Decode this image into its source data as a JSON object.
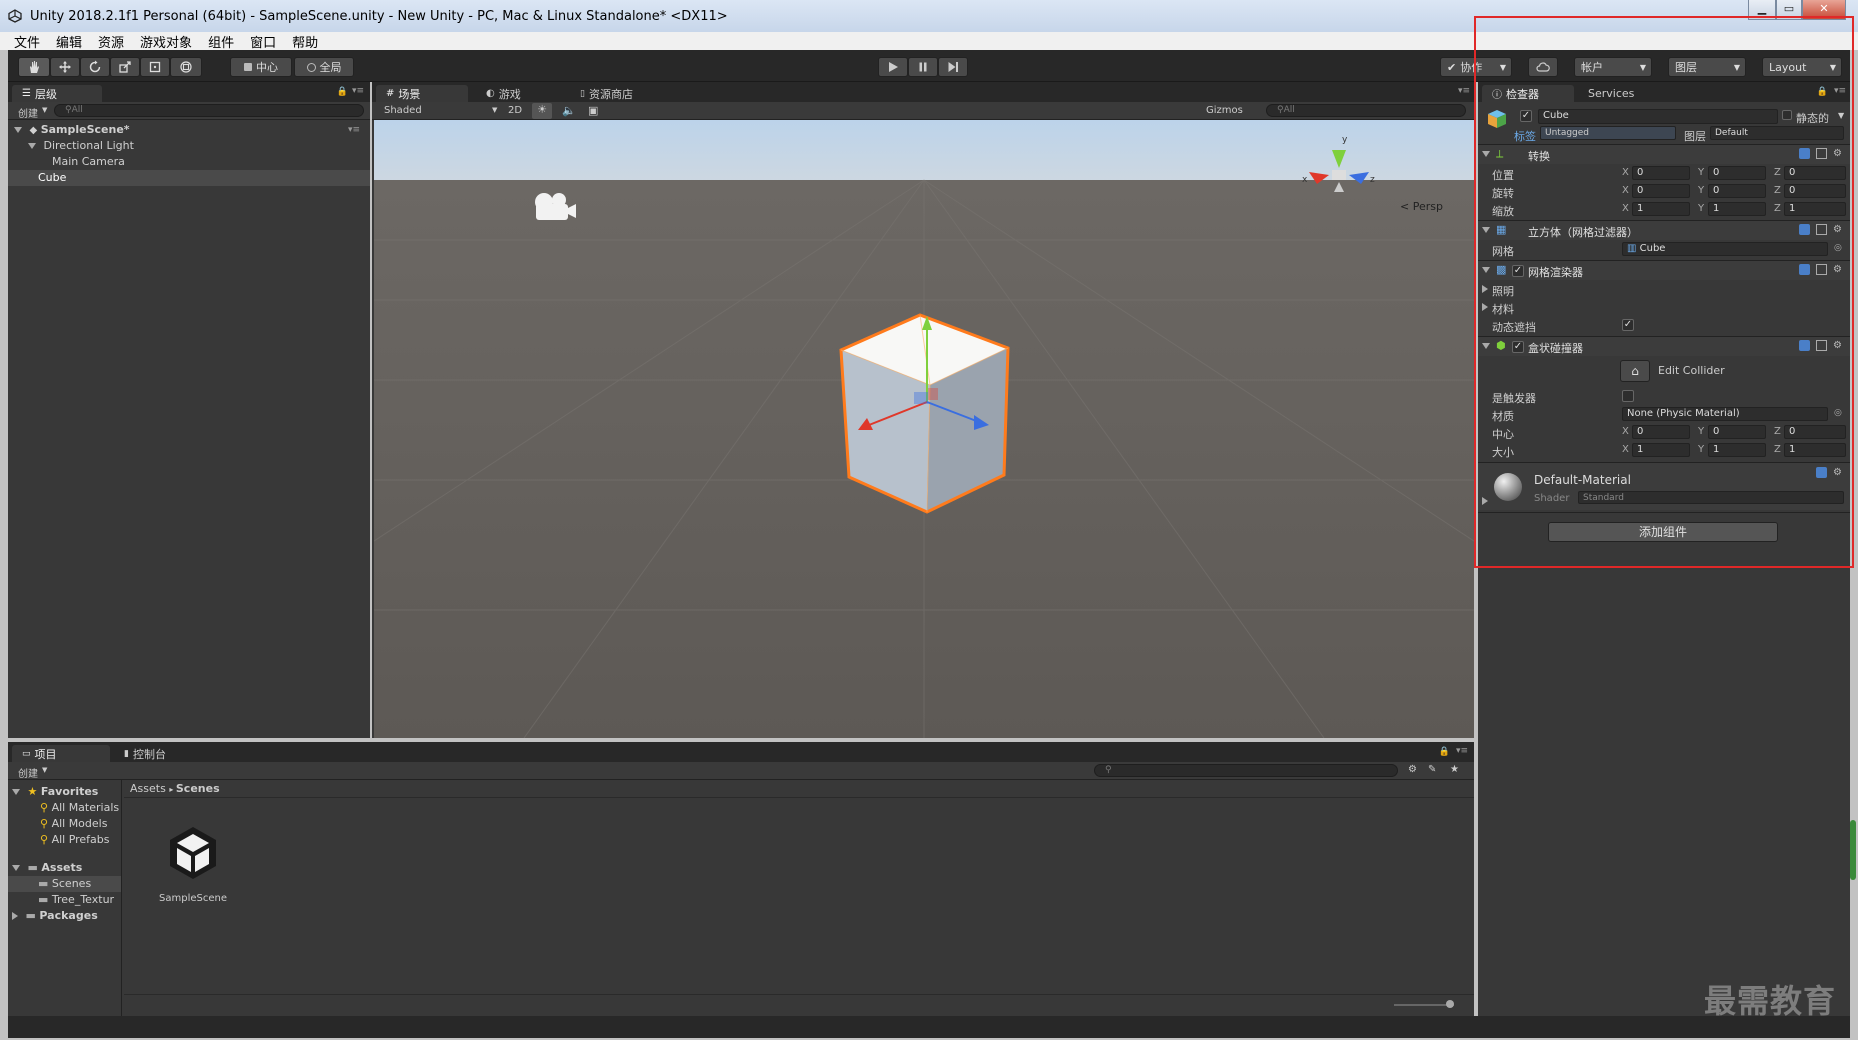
{
  "window": {
    "title": "Unity 2018.2.1f1 Personal (64bit) - SampleScene.unity - New Unity - PC, Mac & Linux Standalone* <DX11>",
    "minimize": "▁",
    "maximize": "▭",
    "close": "✕"
  },
  "menu": [
    "文件",
    "编辑",
    "资源",
    "游戏对象",
    "组件",
    "窗口",
    "帮助"
  ],
  "toolbar": {
    "pivot": "中心",
    "global": "全局",
    "collab": "协作",
    "account": "帐户",
    "layers": "图层",
    "layout": "Layout"
  },
  "hierarchy": {
    "tab": "层级",
    "create": "创建",
    "search_placeholder": "All",
    "scene": "SampleScene*",
    "items": [
      "Directional Light",
      "Main Camera",
      "Cube"
    ]
  },
  "scene_view": {
    "tabs": [
      "场景",
      "游戏",
      "资源商店"
    ],
    "shading": "Shaded",
    "mode_2d": "2D",
    "gizmos": "Gizmos",
    "search_placeholder": "All",
    "persp": "< Persp"
  },
  "inspector": {
    "tabs": [
      "检查器",
      "Services"
    ],
    "object_name": "Cube",
    "static_label": "静态的",
    "tag_label": "标签",
    "tag_value": "Untagged",
    "layer_label": "图层",
    "layer_value": "Default",
    "transform": {
      "title": "转换",
      "position_label": "位置",
      "rotation_label": "旋转",
      "scale_label": "缩放",
      "position": [
        "0",
        "0",
        "0"
      ],
      "rotation": [
        "0",
        "0",
        "0"
      ],
      "scale": [
        "1",
        "1",
        "1"
      ]
    },
    "mesh_filter": {
      "title": "立方体（网格过滤器）",
      "mesh_label": "网格",
      "mesh_value": "Cube"
    },
    "mesh_renderer": {
      "title": "网格渲染器",
      "lighting": "照明",
      "materials": "材料",
      "dynamic_occluded": "动态遮挡"
    },
    "box_collider": {
      "title": "盒状碰撞器",
      "edit_collider": "Edit Collider",
      "is_trigger": "是触发器",
      "material_label": "材质",
      "material_value": "None (Physic Material)",
      "center_label": "中心",
      "size_label": "大小",
      "center": [
        "0",
        "0",
        "0"
      ],
      "size": [
        "1",
        "1",
        "1"
      ]
    },
    "material": {
      "name": "Default-Material",
      "shader_label": "Shader",
      "shader_value": "Standard"
    },
    "add_component": "添加组件"
  },
  "project": {
    "tabs": [
      "项目",
      "控制台"
    ],
    "create": "创建",
    "favorites": "Favorites",
    "favorite_items": [
      "All Materials",
      "All Models",
      "All Prefabs"
    ],
    "assets": "Assets",
    "asset_folders": [
      "Scenes",
      "Tree_Textur"
    ],
    "packages": "Packages",
    "breadcrumb": [
      "Assets",
      "Scenes"
    ],
    "files": [
      "SampleScene"
    ]
  },
  "axis_labels": {
    "x": "x",
    "y": "y",
    "z": "z"
  },
  "watermark": "最需教育",
  "colors": {
    "highlight": "#e02828",
    "selection": "#ff7b1c",
    "accent_blue": "#3d6fb6"
  }
}
